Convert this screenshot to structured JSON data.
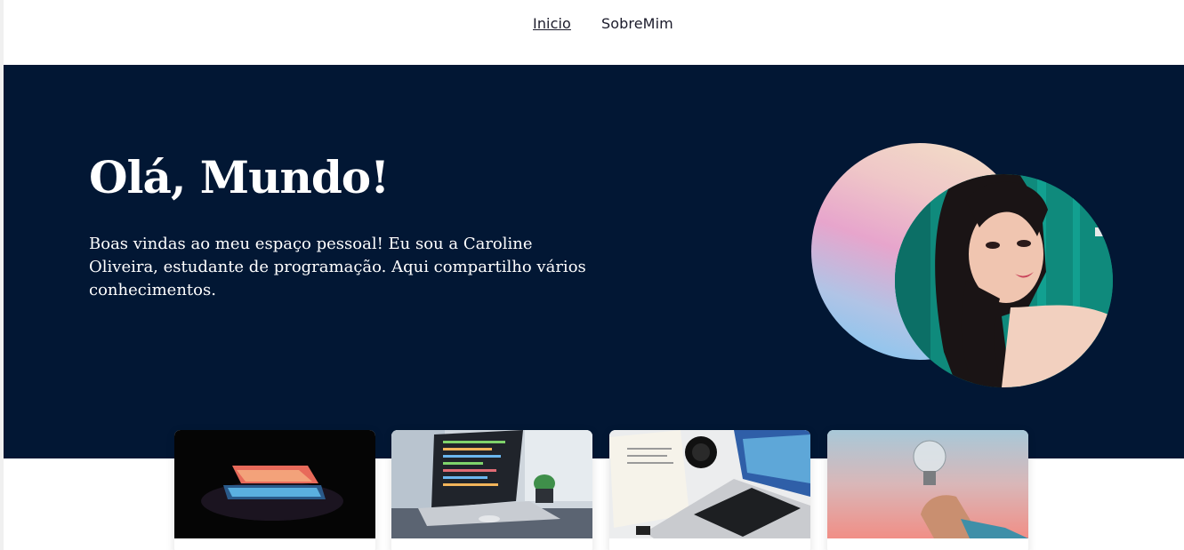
{
  "nav": {
    "links": [
      {
        "label": "Inicio",
        "active": true
      },
      {
        "label": "SobreMim",
        "active": false
      }
    ]
  },
  "hero": {
    "title": "Olá, Mundo!",
    "text": "Boas vindas ao meu espaço pessoal! Eu sou a Caroline Oliveira, estudante de programação. Aqui compartilho vários conhecimentos.",
    "background_color": "#021734"
  },
  "cards": [
    {
      "image": "glowing-laptop-image"
    },
    {
      "image": "laptop-code-desk-image"
    },
    {
      "image": "laptop-notebook-camera-image"
    },
    {
      "image": "hand-holding-lightbulb-image"
    }
  ],
  "colors": {
    "hero_bg": "#021734",
    "text_light": "#ffffff",
    "nav_text": "#1b1b2b"
  }
}
